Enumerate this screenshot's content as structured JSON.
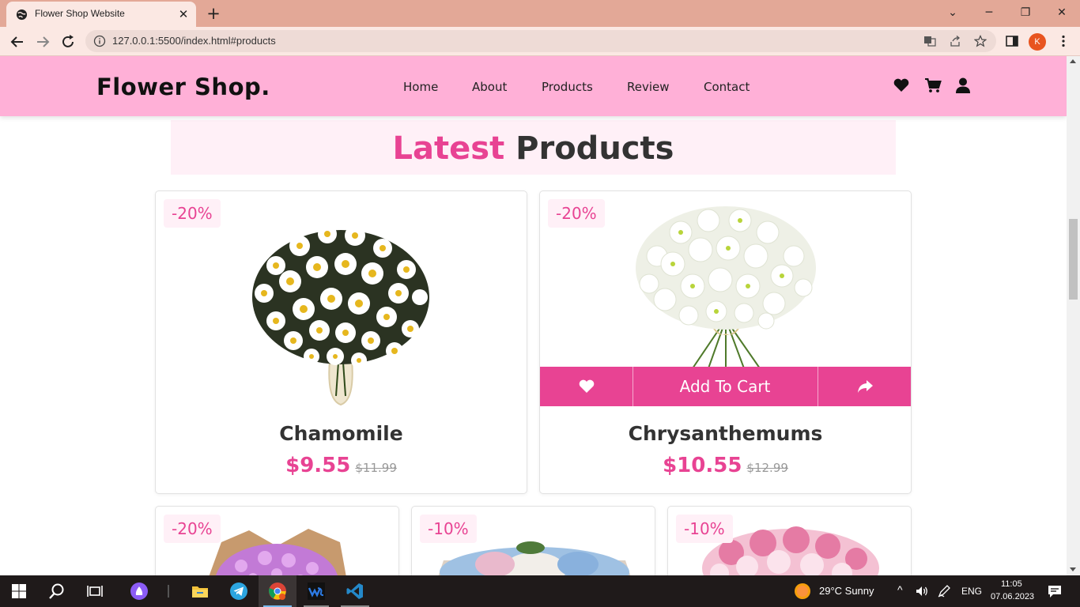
{
  "browser": {
    "tab_title": "Flower Shop Website",
    "url": "127.0.0.1:5500/index.html#products",
    "profile_initial": "K"
  },
  "site": {
    "logo": "Flower Shop.",
    "nav": [
      "Home",
      "About",
      "Products",
      "Review",
      "Contact"
    ],
    "heading_accent": "Latest",
    "heading_rest": "Products"
  },
  "products": [
    {
      "discount": "-20%",
      "name": "Chamomile",
      "price": "$9.55",
      "old_price": "$11.99"
    },
    {
      "discount": "-20%",
      "name": "Chrysanthemums",
      "price": "$10.55",
      "old_price": "$12.99",
      "add_to_cart": "Add To Cart"
    },
    {
      "discount": "-20%"
    },
    {
      "discount": "-10%"
    },
    {
      "discount": "-10%"
    }
  ],
  "taskbar": {
    "weather": "29°C  Sunny",
    "lang": "ENG",
    "time": "11:05",
    "date": "07.06.2023"
  },
  "colors": {
    "accent": "#e84393",
    "header_bg": "#ffb0d7",
    "tab_strip": "#e3a897"
  }
}
